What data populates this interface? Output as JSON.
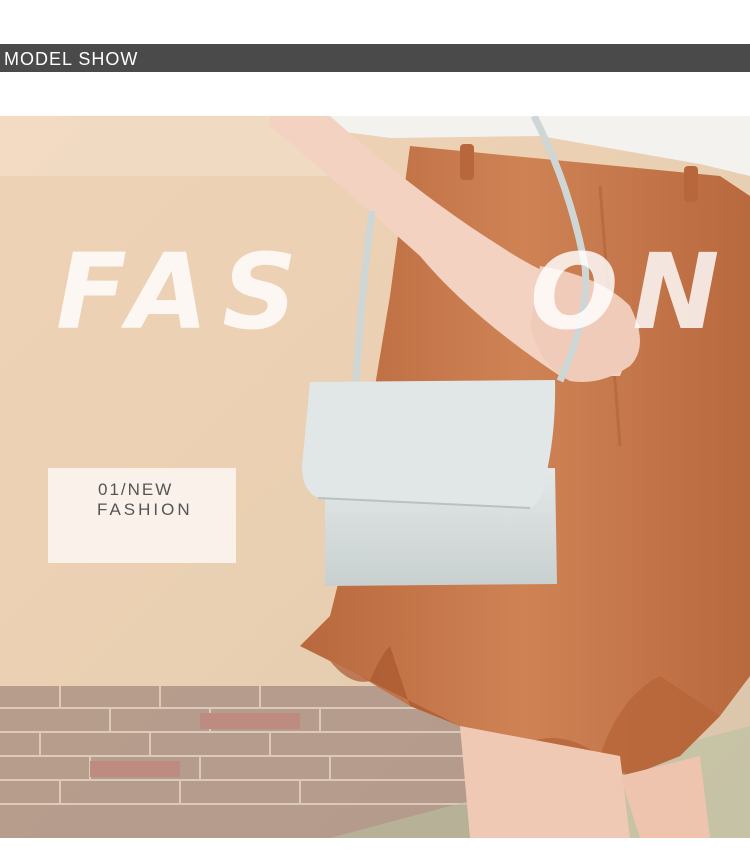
{
  "header": {
    "title": "MODEL SHOW"
  },
  "hero": {
    "word_left": "FAS",
    "word_right": "ON",
    "tag_line1": "01/NEW",
    "tag_line2": "FASHION"
  },
  "colors": {
    "header_bg": "#4a4a4a",
    "skirt": "#c87a4e",
    "bag": "#d6dcdc",
    "background": "#e7c9a8"
  },
  "icons": [
    "crossbody-bag-illustration"
  ]
}
